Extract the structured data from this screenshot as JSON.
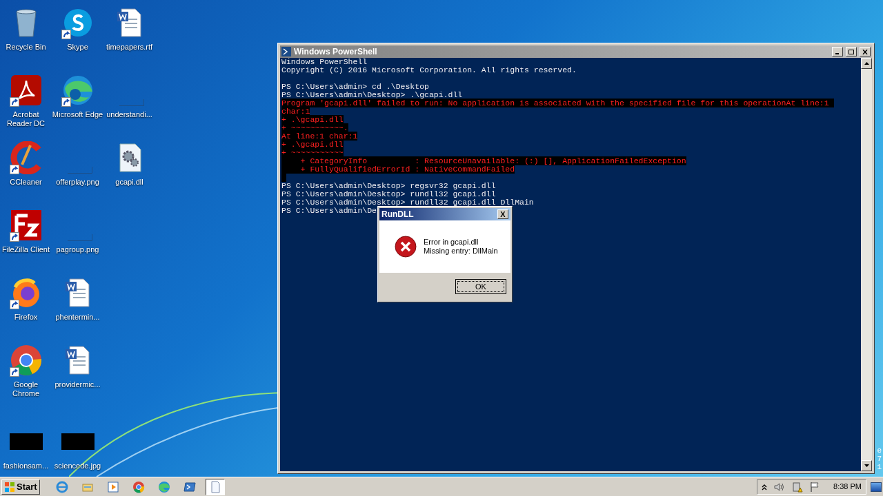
{
  "desktop_icons": [
    [
      {
        "label": "Recycle Bin",
        "kind": "recycle",
        "shortcut": false
      },
      {
        "label": "Skype",
        "kind": "skype",
        "shortcut": true
      },
      {
        "label": "timepapers.rtf",
        "kind": "word",
        "shortcut": false
      }
    ],
    [
      {
        "label": "Acrobat Reader DC",
        "kind": "acrobat",
        "shortcut": true
      },
      {
        "label": "Microsoft Edge",
        "kind": "edge",
        "shortcut": true
      },
      {
        "label": "understandi...",
        "kind": "blank",
        "shortcut": false
      }
    ],
    [
      {
        "label": "CCleaner",
        "kind": "ccleaner",
        "shortcut": true
      },
      {
        "label": "offerplay.png",
        "kind": "blank",
        "shortcut": false
      },
      {
        "label": "gcapi.dll",
        "kind": "dll",
        "shortcut": false
      }
    ],
    [
      {
        "label": "FileZilla Client",
        "kind": "filezilla",
        "shortcut": true
      },
      {
        "label": "pagroup.png",
        "kind": "blank",
        "shortcut": false
      }
    ],
    [
      {
        "label": "Firefox",
        "kind": "firefox",
        "shortcut": true
      },
      {
        "label": "phentermin...",
        "kind": "word",
        "shortcut": false
      }
    ],
    [
      {
        "label": "Google Chrome",
        "kind": "chrome",
        "shortcut": true
      },
      {
        "label": "providermic...",
        "kind": "word",
        "shortcut": false
      }
    ],
    [
      {
        "label": "fashionsam...",
        "kind": "thumb",
        "shortcut": false
      },
      {
        "label": "sciencede.jpg",
        "kind": "thumb",
        "shortcut": false
      }
    ]
  ],
  "console": {
    "title": "Windows PowerShell",
    "lines": [
      {
        "kind": "output",
        "text": "Windows PowerShell"
      },
      {
        "kind": "output",
        "text": "Copyright (C) 2016 Microsoft Corporation. All rights reserved."
      },
      {
        "kind": "blank"
      },
      {
        "kind": "output",
        "text": "PS C:\\Users\\admin> cd .\\Desktop"
      },
      {
        "kind": "output",
        "text": "PS C:\\Users\\admin\\Desktop> .\\gcapi.dll"
      },
      {
        "kind": "error",
        "text": "Program 'gcapi.dll' failed to run: No application is associated with the specified file for this operationAt line:1 "
      },
      {
        "kind": "error",
        "text": "char:1"
      },
      {
        "kind": "error",
        "text": "+ .\\gcapi.dll"
      },
      {
        "kind": "error",
        "text": "+ ~~~~~~~~~~~."
      },
      {
        "kind": "error",
        "text": "At line:1 char:1"
      },
      {
        "kind": "error",
        "text": "+ .\\gcapi.dll"
      },
      {
        "kind": "error",
        "text": "+ ~~~~~~~~~~~"
      },
      {
        "kind": "error",
        "text": "    + CategoryInfo          : ResourceUnavailable: (:) [], ApplicationFailedException"
      },
      {
        "kind": "error",
        "text": "    + FullyQualifiedErrorId : NativeCommandFailed"
      },
      {
        "kind": "block"
      },
      {
        "kind": "output",
        "text": "PS C:\\Users\\admin\\Desktop> regsvr32 gcapi.dll"
      },
      {
        "kind": "output",
        "text": "PS C:\\Users\\admin\\Desktop> rundll32 gcapi.dll"
      },
      {
        "kind": "output",
        "text": "PS C:\\Users\\admin\\Desktop> rundll32 gcapi.dll DllMain"
      },
      {
        "kind": "output",
        "text": "PS C:\\Users\\admin\\De"
      }
    ]
  },
  "dialog": {
    "title": "RunDLL",
    "close": "X",
    "message": [
      "Error in gcapi.dll",
      "Missing entry: DllMain"
    ],
    "button": "OK"
  },
  "edge_text": [
    "e",
    "7",
    "1"
  ],
  "taskbar": {
    "start": "Start",
    "apps": [
      {
        "kind": "ie",
        "active": false
      },
      {
        "kind": "explorer",
        "active": false
      },
      {
        "kind": "media",
        "active": false
      },
      {
        "kind": "chrome",
        "active": false
      },
      {
        "kind": "edge",
        "active": false
      },
      {
        "kind": "powershell",
        "active": false
      },
      {
        "kind": "document",
        "active": true
      }
    ],
    "clock": "8:38 PM"
  }
}
